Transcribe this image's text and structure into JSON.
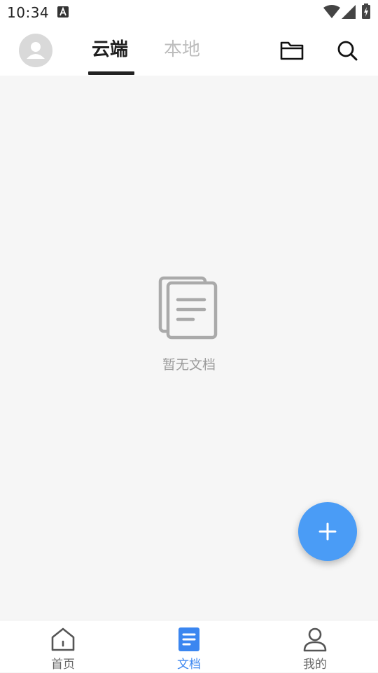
{
  "status_bar": {
    "time": "10:34"
  },
  "header": {
    "tabs": [
      {
        "label": "云端",
        "active": true
      },
      {
        "label": "本地",
        "active": false
      }
    ]
  },
  "empty_state": {
    "message": "暂无文档"
  },
  "bottom_nav": {
    "items": [
      {
        "label": "首页",
        "icon": "home-icon",
        "active": false
      },
      {
        "label": "文档",
        "icon": "document-icon",
        "active": true
      },
      {
        "label": "我的",
        "icon": "profile-icon",
        "active": false
      }
    ]
  },
  "colors": {
    "accent": "#4a9cf6",
    "active_nav": "#3b86f0",
    "background": "#f6f6f6"
  }
}
